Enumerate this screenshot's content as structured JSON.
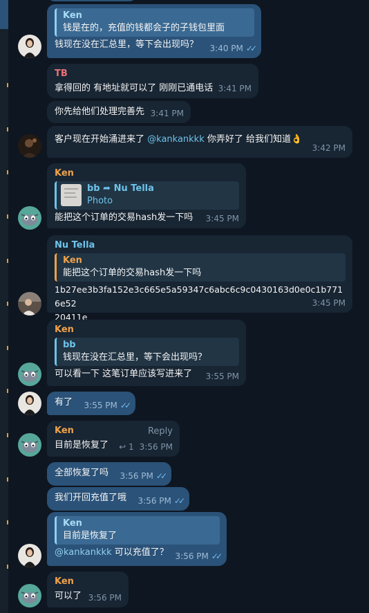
{
  "messages": {
    "m1": {
      "quote_name": "Ken",
      "quote_text": "钱是在的，充值的钱都会子的子钱包里面",
      "text": "钱现在没在汇总里，等下会出现吗？",
      "time": "3:40 PM"
    },
    "m2": {
      "sender": "TB",
      "text": "拿得回的 有地址就可以了 刚刚已通电话",
      "time": "3:41 PM"
    },
    "m3": {
      "text": "你先给他们处理完善先",
      "time": "3:41 PM"
    },
    "m4": {
      "text_before": "客户现在开始涌进来了 ",
      "mention": "@kankankkk",
      "text_after": " 你弄好了 给我们知道👌",
      "time": "3:42 PM"
    },
    "m5": {
      "sender": "Ken",
      "quote_from": "bb",
      "quote_to": "Nu Tella",
      "quote_text": "Photo",
      "text": "能把这个订单的交易hash发一下吗",
      "time": "3:45 PM"
    },
    "m6": {
      "sender": "Nu Tella",
      "quote_name": "Ken",
      "quote_text": "能把这个订单的交易hash发一下吗",
      "text": "1b27ee3b3fa152e3c665e5a59347c6abc6c9c0430163d0e0c1b7716e52\n20411e",
      "time": "3:45 PM"
    },
    "m7": {
      "sender": "Ken",
      "quote_name": "bb",
      "quote_text": "钱现在没在汇总里，等下会出现吗？",
      "text": "可以看一下 这笔订单应该写进来了",
      "time": "3:55 PM"
    },
    "m8": {
      "text": "有了",
      "time": "3:55 PM"
    },
    "m9": {
      "sender": "Ken",
      "reply_label": "Reply",
      "text": "目前是恢复了",
      "reply_count": "1",
      "time": "3:56 PM"
    },
    "m10": {
      "text": "全部恢复了吗",
      "time": "3:56 PM"
    },
    "m11": {
      "text": "我们开回充值了哦",
      "time": "3:56 PM"
    },
    "m12": {
      "quote_name": "Ken",
      "quote_text": "目前是恢复了",
      "mention": "@kankankkk",
      "text_after": " 可以充值了？",
      "time": "3:56 PM"
    },
    "m13": {
      "sender": "Ken",
      "text": "可以了",
      "time": "3:56 PM"
    }
  },
  "icons": {
    "read_ticks": "double-check-icon",
    "forward": "forward-arrow-icon",
    "reply_arrow": "reply-arrow-icon",
    "ok_emoji": "ok-hand-emoji"
  },
  "colors": {
    "background": "#0e1621",
    "bubble_incoming": "#182533",
    "bubble_outgoing": "#2b5278",
    "sender_orange": "#f0a24a",
    "sender_blue": "#6ec3ea",
    "sender_red": "#ed7176"
  }
}
